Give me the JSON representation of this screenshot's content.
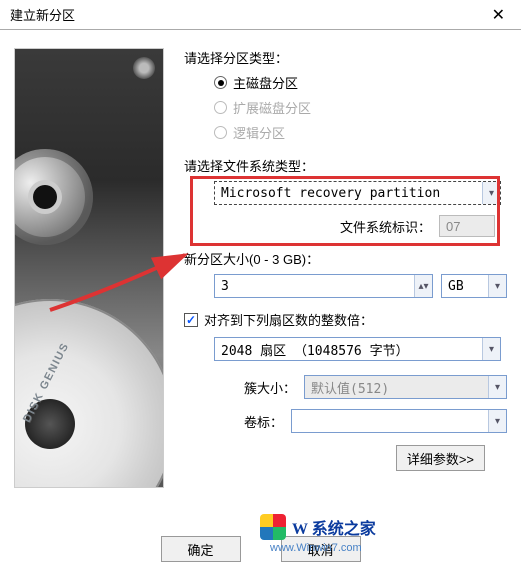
{
  "window": {
    "title": "建立新分区",
    "close_glyph": "✕"
  },
  "sidebar": {
    "brand": "DISK GENIUS"
  },
  "partition_type": {
    "label": "请选择分区类型：",
    "options": {
      "primary": "主磁盘分区",
      "extended": "扩展磁盘分区",
      "logical": "逻辑分区"
    }
  },
  "filesystem": {
    "label": "请选择文件系统类型：",
    "selected": "Microsoft recovery partition",
    "id_label": "文件系统标识：",
    "id_value": "07"
  },
  "size": {
    "label": "新分区大小(0 - 3 GB)：",
    "value": "3",
    "unit": "GB"
  },
  "align": {
    "label": "对齐到下列扇区数的整数倍：",
    "value": "2048 扇区 （1048576 字节）"
  },
  "cluster": {
    "label": "簇大小：",
    "value": "默认值(512)"
  },
  "volume": {
    "label": "卷标：",
    "value": ""
  },
  "buttons": {
    "details": "详细参数>>",
    "ok": "确定",
    "cancel": "取消"
  },
  "watermark": {
    "line1": "W 系统之家",
    "line2": "www.Winwin7.com"
  }
}
